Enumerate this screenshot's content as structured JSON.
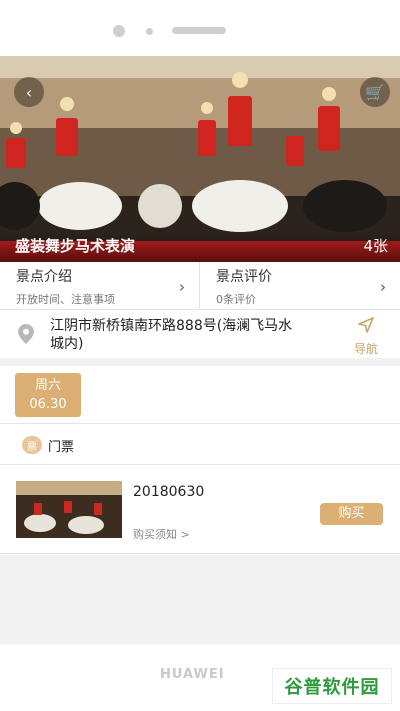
{
  "hero": {
    "title": "盛装舞步马术表演",
    "count": "4张"
  },
  "info": {
    "intro_title": "景点介绍",
    "intro_sub": "开放时间、注意事项",
    "review_title": "景点评价",
    "review_sub": "0条评价"
  },
  "address": {
    "text": "江阴市新桥镇南环路888号(海澜飞马水城内)",
    "nav_label": "导航"
  },
  "date_chip": {
    "weekday": "周六",
    "date": "06.30"
  },
  "tickets": {
    "label": "门票",
    "icon_glyph": "票",
    "item": {
      "date": "20180630",
      "notice": "购买须知 >",
      "buy_label": "购买"
    }
  },
  "device": {
    "brand": "HUAWEI"
  },
  "watermark": {
    "text": "谷普软件园"
  },
  "colors": {
    "accent": "#dcaf74"
  }
}
